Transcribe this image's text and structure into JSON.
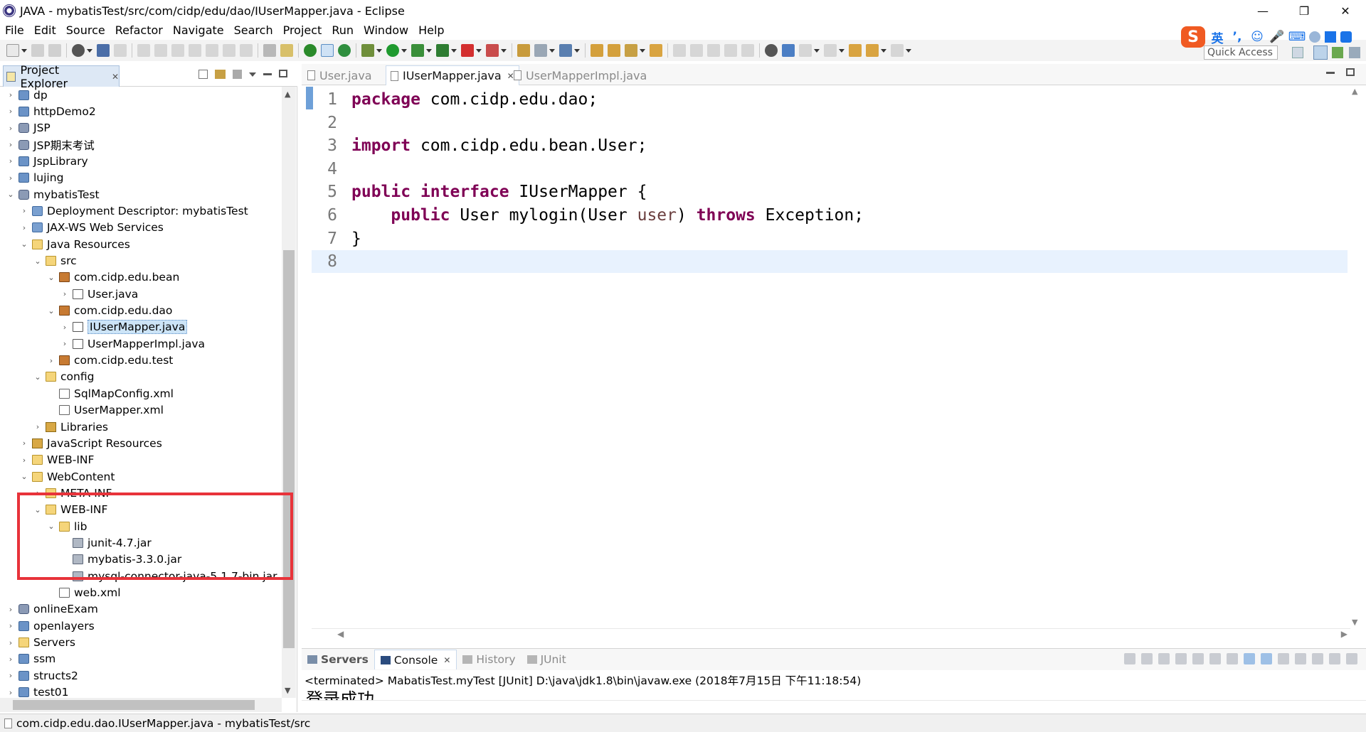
{
  "window": {
    "title": "JAVA - mybatisTest/src/com/cidp/edu/dao/IUserMapper.java - Eclipse",
    "controls": {
      "minimize": "—",
      "maximize": "❐",
      "close": "✕"
    }
  },
  "menu": [
    "File",
    "Edit",
    "Source",
    "Refactor",
    "Navigate",
    "Search",
    "Project",
    "Run",
    "Window",
    "Help"
  ],
  "toolbar": {
    "quick_access_placeholder": "Quick Access"
  },
  "ime": {
    "logo": "S",
    "lang": "英",
    "punct": "’,",
    "emoji": "☺",
    "mic": "🎤",
    "keyboard": "⌨"
  },
  "explorer": {
    "title": "Project Explorer",
    "tab_close": "✕",
    "tree": [
      {
        "label": "dp",
        "depth": 0,
        "expanded": false,
        "icon": "project-icon"
      },
      {
        "label": "httpDemo2",
        "depth": 0,
        "expanded": false,
        "icon": "project-icon"
      },
      {
        "label": "JSP",
        "depth": 0,
        "expanded": false,
        "icon": "web-project-icon"
      },
      {
        "label": "JSP期末考试",
        "depth": 0,
        "expanded": false,
        "icon": "web-project-icon"
      },
      {
        "label": "JspLibrary",
        "depth": 0,
        "expanded": false,
        "icon": "project-icon"
      },
      {
        "label": "lujing",
        "depth": 0,
        "expanded": false,
        "icon": "project-icon"
      },
      {
        "label": "mybatisTest",
        "depth": 0,
        "expanded": true,
        "icon": "web-project-icon"
      },
      {
        "label": "Deployment Descriptor: mybatisTest",
        "depth": 1,
        "expanded": false,
        "icon": "descriptor-icon"
      },
      {
        "label": "JAX-WS Web Services",
        "depth": 1,
        "expanded": false,
        "icon": "webservice-icon"
      },
      {
        "label": "Java Resources",
        "depth": 1,
        "expanded": true,
        "icon": "resources-icon"
      },
      {
        "label": "src",
        "depth": 2,
        "expanded": true,
        "icon": "source-folder-icon"
      },
      {
        "label": "com.cidp.edu.bean",
        "depth": 3,
        "expanded": true,
        "icon": "package-icon"
      },
      {
        "label": "User.java",
        "depth": 4,
        "expanded": false,
        "icon": "java-file-icon"
      },
      {
        "label": "com.cidp.edu.dao",
        "depth": 3,
        "expanded": true,
        "icon": "package-icon"
      },
      {
        "label": "IUserMapper.java",
        "depth": 4,
        "expanded": false,
        "icon": "java-file-icon",
        "selected": true
      },
      {
        "label": "UserMapperImpl.java",
        "depth": 4,
        "expanded": false,
        "icon": "java-file-icon"
      },
      {
        "label": "com.cidp.edu.test",
        "depth": 3,
        "expanded": false,
        "icon": "package-icon"
      },
      {
        "label": "config",
        "depth": 2,
        "expanded": true,
        "icon": "source-folder-icon"
      },
      {
        "label": "SqlMapConfig.xml",
        "depth": 3,
        "icon": "xml-file-icon"
      },
      {
        "label": "UserMapper.xml",
        "depth": 3,
        "icon": "xml-file-icon"
      },
      {
        "label": "Libraries",
        "depth": 2,
        "expanded": false,
        "icon": "libraries-icon"
      },
      {
        "label": "JavaScript Resources",
        "depth": 1,
        "expanded": false,
        "icon": "libraries-icon"
      },
      {
        "label": "WEB-INF",
        "depth": 1,
        "expanded": false,
        "icon": "folder-icon"
      },
      {
        "label": "WebContent",
        "depth": 1,
        "expanded": true,
        "icon": "folder-icon"
      },
      {
        "label": "META-INF",
        "depth": 2,
        "expanded": false,
        "icon": "folder-icon"
      },
      {
        "label": "WEB-INF",
        "depth": 2,
        "expanded": true,
        "icon": "folder-icon"
      },
      {
        "label": "lib",
        "depth": 3,
        "expanded": true,
        "icon": "folder-icon"
      },
      {
        "label": "junit-4.7.jar",
        "depth": 4,
        "icon": "jar-icon"
      },
      {
        "label": "mybatis-3.3.0.jar",
        "depth": 4,
        "icon": "jar-icon"
      },
      {
        "label": "mysql-connector-java-5.1.7-bin.jar",
        "depth": 4,
        "icon": "jar-icon"
      },
      {
        "label": "web.xml",
        "depth": 3,
        "icon": "xml-file-icon"
      },
      {
        "label": "onlineExam",
        "depth": 0,
        "expanded": false,
        "icon": "web-project-icon"
      },
      {
        "label": "openlayers",
        "depth": 0,
        "expanded": false,
        "icon": "project-icon"
      },
      {
        "label": "Servers",
        "depth": 0,
        "expanded": false,
        "icon": "folder-icon"
      },
      {
        "label": "ssm",
        "depth": 0,
        "expanded": false,
        "icon": "project-icon"
      },
      {
        "label": "structs2",
        "depth": 0,
        "expanded": false,
        "icon": "project-icon"
      },
      {
        "label": "test01",
        "depth": 0,
        "expanded": false,
        "icon": "project-icon"
      }
    ]
  },
  "editor": {
    "tabs": [
      {
        "label": "User.java",
        "active": false
      },
      {
        "label": "IUserMapper.java",
        "active": true,
        "close": "✕"
      },
      {
        "label": "UserMapperImpl.java",
        "active": false
      }
    ],
    "current_line": 8,
    "lines": [
      {
        "num": "1",
        "tokens": [
          {
            "t": "package",
            "c": "kw"
          },
          {
            "t": " com.cidp.edu.dao;",
            "c": "plain"
          }
        ]
      },
      {
        "num": "2",
        "tokens": []
      },
      {
        "num": "3",
        "tokens": [
          {
            "t": "import",
            "c": "kw"
          },
          {
            "t": " com.cidp.edu.bean.User;",
            "c": "plain"
          }
        ]
      },
      {
        "num": "4",
        "tokens": []
      },
      {
        "num": "5",
        "tokens": [
          {
            "t": "public",
            "c": "kw"
          },
          {
            "t": " ",
            "c": "plain"
          },
          {
            "t": "interface",
            "c": "kw"
          },
          {
            "t": " IUserMapper {",
            "c": "plain"
          }
        ]
      },
      {
        "num": "6",
        "tokens": [
          {
            "t": "    ",
            "c": "plain"
          },
          {
            "t": "public",
            "c": "kw"
          },
          {
            "t": " User mylogin(User ",
            "c": "plain"
          },
          {
            "t": "user",
            "c": "param"
          },
          {
            "t": ") ",
            "c": "plain"
          },
          {
            "t": "throws",
            "c": "kw"
          },
          {
            "t": " Exception;",
            "c": "plain"
          }
        ]
      },
      {
        "num": "7",
        "tokens": [
          {
            "t": "}",
            "c": "plain"
          }
        ]
      },
      {
        "num": "8",
        "tokens": []
      }
    ]
  },
  "console": {
    "tabs": [
      {
        "label": "Servers",
        "bold": true
      },
      {
        "label": "Console",
        "active": true,
        "close": "✕"
      },
      {
        "label": "History"
      },
      {
        "label": "JUnit"
      }
    ],
    "status": "<terminated> MabatisTest.myTest [JUnit] D:\\java\\jdk1.8\\bin\\javaw.exe (2018年7月15日 下午11:18:54)",
    "output": "登录成功"
  },
  "statusbar": {
    "text": "com.cidp.edu.dao.IUserMapper.java - mybatisTest/src"
  },
  "colors": {
    "keyword": "#7f0055",
    "current_line": "#e8f2fe",
    "highlight_box": "#e8333a",
    "selection": "#cce4f7"
  }
}
